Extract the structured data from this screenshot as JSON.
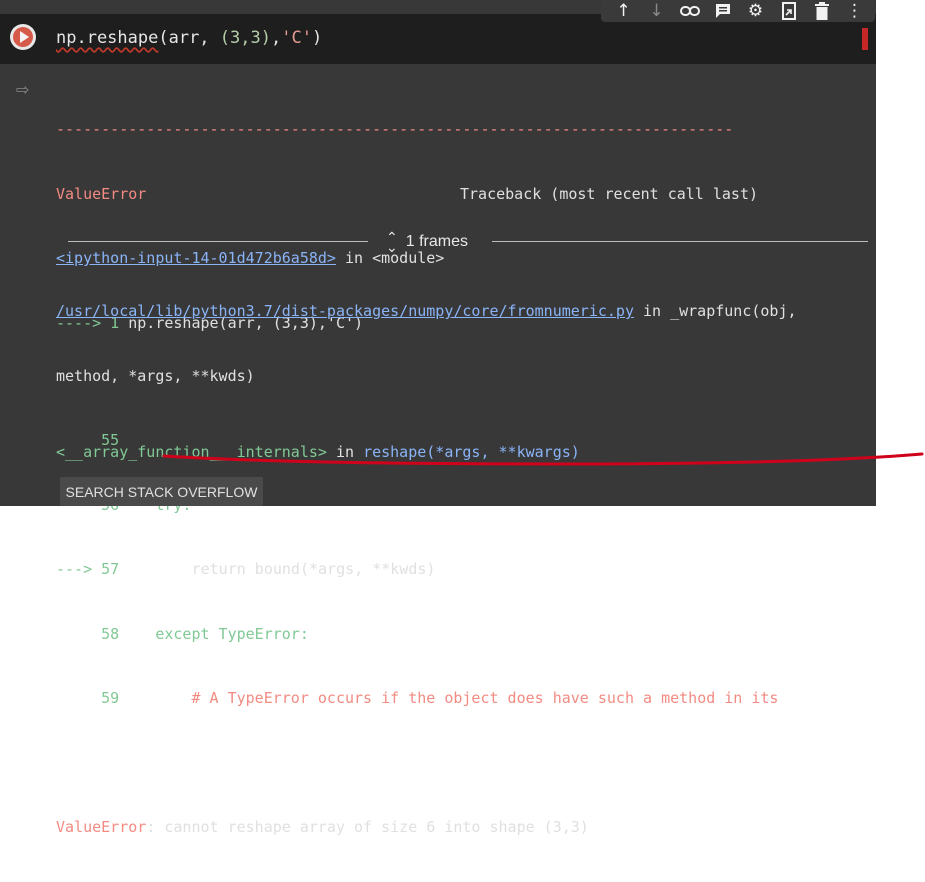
{
  "cell": {
    "code": {
      "fn": "np.reshape",
      "open": "(arr, ",
      "tuple": "(3,3)",
      "comma": ",",
      "order": "'C'",
      "close": ")"
    }
  },
  "toolbar": {
    "icons": [
      "arrow-up-icon",
      "arrow-down-icon",
      "link-icon",
      "comment-icon",
      "gear-icon",
      "mirror-cell-icon",
      "trash-icon",
      "more-vert-icon"
    ]
  },
  "output": {
    "dashes": "---------------------------------------------------------------------------",
    "error_name": "ValueError",
    "traceback_header": "Traceback (most recent call last)",
    "frame1_link": "<ipython-input-14-01d472b6a58d>",
    "frame1_in": " in <module>",
    "frame1_arrow": "----> 1 ",
    "frame1_code": "np.reshape(arr, (3,3),'C')",
    "frame2_internals": "<__array_function__ internals>",
    "frame2_in": " in ",
    "frame2_func": "reshape(*args, **kwargs)",
    "frames_label": "1 frames",
    "frame3_link": "/usr/local/lib/python3.7/dist-packages/numpy/core/fromnumeric.py",
    "frame3_in": " in _wrapfunc(obj,",
    "frame3_cont": "method, *args, **kwds)",
    "src": [
      {
        "num": "     55",
        "arrow": "",
        "code": ""
      },
      {
        "num": "     56",
        "arrow": "",
        "code": "    try:"
      },
      {
        "num": " 57",
        "arrow": "--->",
        "code": "        return bound(*args, **kwds)"
      },
      {
        "num": "     58",
        "arrow": "",
        "code": "    except TypeError:"
      },
      {
        "num": "     59",
        "arrow": "",
        "code": "        # A TypeError occurs if the object does have such a method in its"
      }
    ],
    "final_error_name": "ValueError",
    "final_error_msg": ": cannot reshape array of size 6 into shape (3,3)"
  },
  "buttons": {
    "search_so": "SEARCH STACK OVERFLOW"
  },
  "colors": {
    "error_red": "#f28b82",
    "green": "#81c995",
    "link_blue": "#8ab4f8",
    "annotation_red": "#d0021b"
  }
}
